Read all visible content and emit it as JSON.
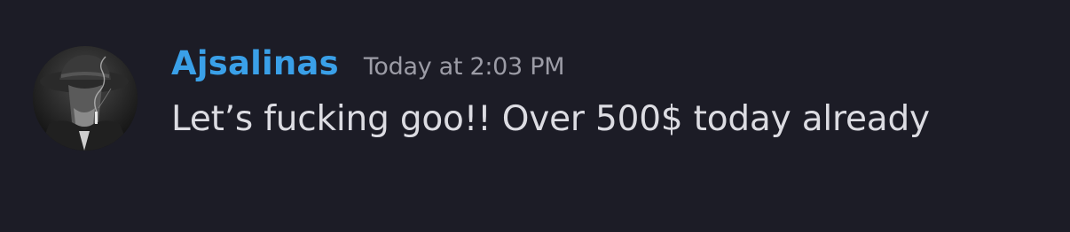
{
  "message": {
    "author": {
      "username": "Ajsalinas",
      "username_color": "#3aa0e8",
      "avatar": "user-avatar-image"
    },
    "timestamp": "Today at 2:03 PM",
    "content": "Let’s fucking goo!! Over 500$ today already"
  },
  "colors": {
    "background": "#1c1c26",
    "text": "#dcdce2",
    "timestamp": "#9c9ca6"
  }
}
